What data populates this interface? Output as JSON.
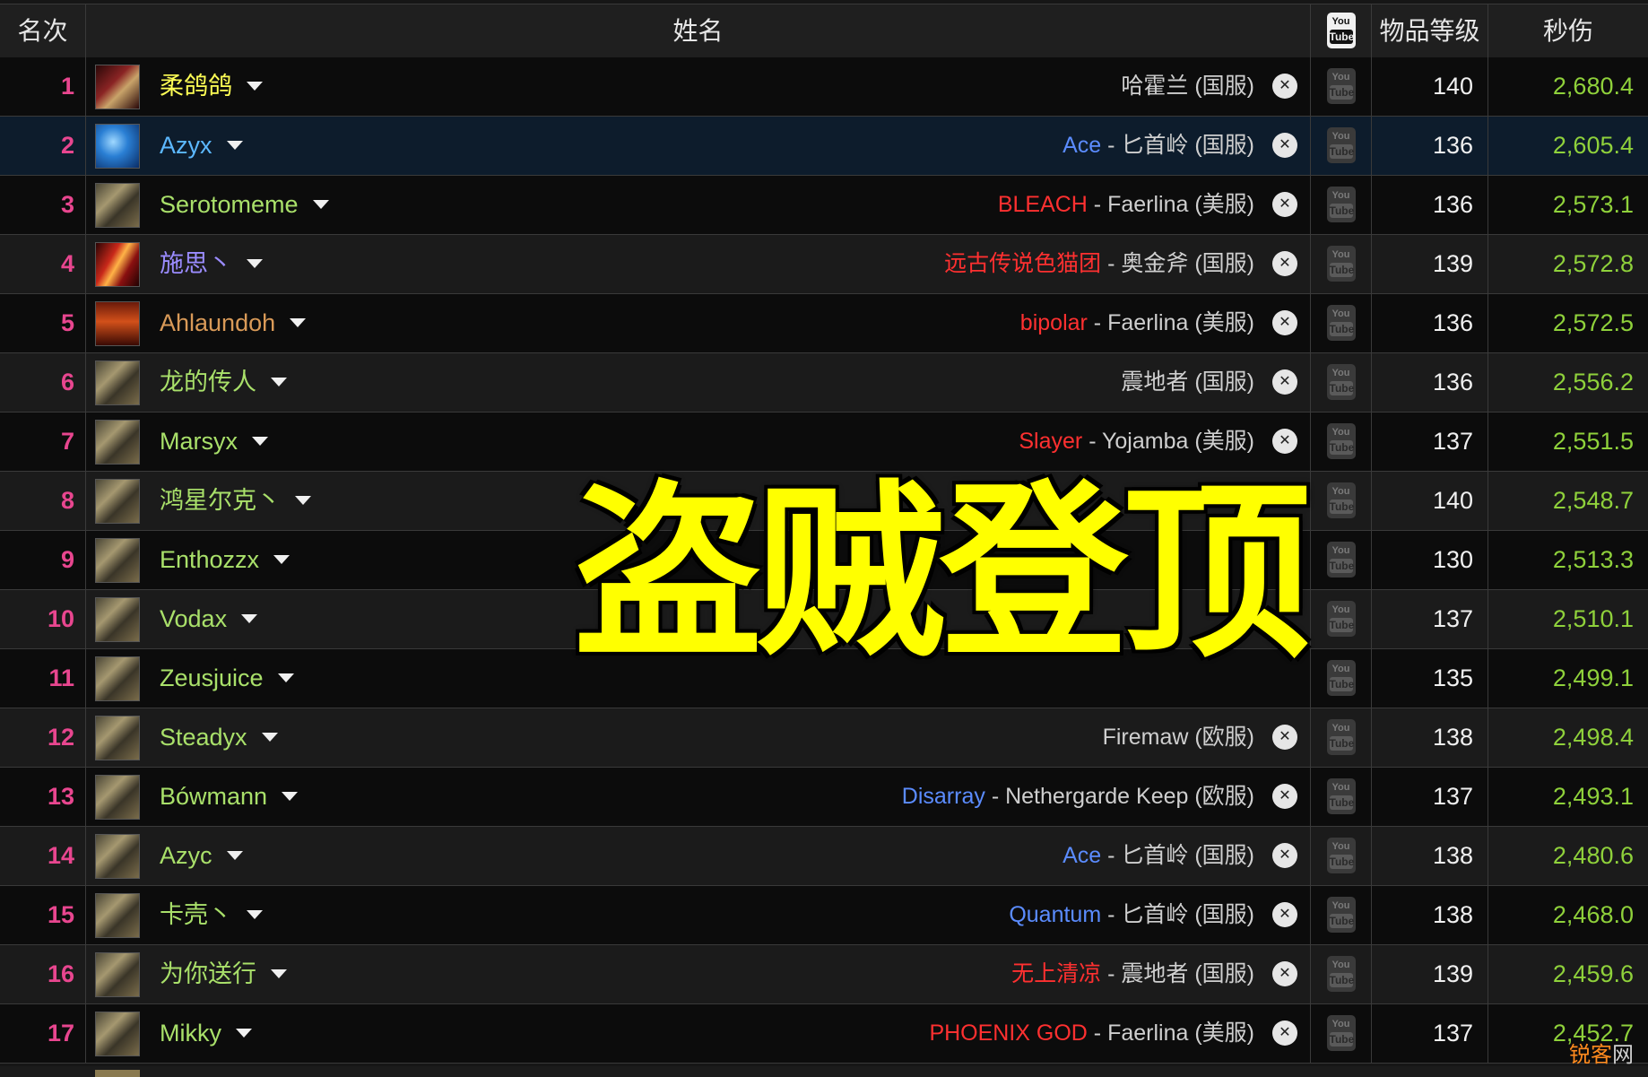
{
  "header": {
    "rank": "名次",
    "name": "姓名",
    "youtube_top": "You",
    "youtube_bottom": "Tube",
    "ilvl": "物品等级",
    "dps": "秒伤"
  },
  "rows": [
    {
      "rank": "1",
      "name": "柔鸽鸽",
      "name_color": "#ffff55",
      "spec": "dk",
      "guild": "",
      "realm": "哈霍兰 (国服)",
      "ilvl": "140",
      "dps": "2,680.4"
    },
    {
      "rank": "2",
      "name": "Azyx",
      "name_color": "#5cb8ff",
      "spec": "mage",
      "guild": "Ace",
      "guild_color": "#5b8cff",
      "realm": "匕首岭 (国服)",
      "ilvl": "136",
      "dps": "2,605.4"
    },
    {
      "rank": "3",
      "name": "Serotomeme",
      "name_color": "#a9e06a",
      "spec": "rogue",
      "guild": "BLEACH",
      "guild_color": "#ff3030",
      "realm": "Faerlina (美服)",
      "ilvl": "136",
      "dps": "2,573.1"
    },
    {
      "rank": "4",
      "name": "施思丶",
      "name_color": "#9b8cff",
      "spec": "fire",
      "guild": "远古传说色猫团",
      "guild_color": "#ff3030",
      "realm": "奥金斧 (国服)",
      "ilvl": "139",
      "dps": "2,572.8"
    },
    {
      "rank": "5",
      "name": "Ahlaundoh",
      "name_color": "#d99a58",
      "spec": "warr",
      "guild": "bipolar",
      "guild_color": "#ff3030",
      "realm": "Faerlina (美服)",
      "ilvl": "136",
      "dps": "2,572.5"
    },
    {
      "rank": "6",
      "name": "龙的传人",
      "name_color": "#a9e06a",
      "spec": "rogue",
      "guild": "",
      "realm": "震地者 (国服)",
      "ilvl": "136",
      "dps": "2,556.2"
    },
    {
      "rank": "7",
      "name": "Marsyx",
      "name_color": "#a9e06a",
      "spec": "rogue",
      "guild": "Slayer",
      "guild_color": "#ff3030",
      "realm": "Yojamba (美服)",
      "ilvl": "137",
      "dps": "2,551.5"
    },
    {
      "rank": "8",
      "name": "鸿星尔克丶",
      "name_color": "#a9e06a",
      "spec": "rogue",
      "guild": "",
      "realm": "",
      "ilvl": "140",
      "dps": "2,548.7"
    },
    {
      "rank": "9",
      "name": "Enthozzx",
      "name_color": "#a9e06a",
      "spec": "rogue",
      "guild": "",
      "realm": "",
      "ilvl": "130",
      "dps": "2,513.3"
    },
    {
      "rank": "10",
      "name": "Vodax",
      "name_color": "#a9e06a",
      "spec": "rogue",
      "guild": "",
      "realm": "",
      "ilvl": "137",
      "dps": "2,510.1"
    },
    {
      "rank": "11",
      "name": "Zeusjuice",
      "name_color": "#a9e06a",
      "spec": "rogue",
      "guild": "",
      "realm": "",
      "ilvl": "135",
      "dps": "2,499.1"
    },
    {
      "rank": "12",
      "name": "Steadyx",
      "name_color": "#a9e06a",
      "spec": "rogue",
      "guild": "",
      "realm": "Firemaw (欧服)",
      "ilvl": "138",
      "dps": "2,498.4"
    },
    {
      "rank": "13",
      "name": "Bówmann",
      "name_color": "#a9e06a",
      "spec": "rogue",
      "guild": "Disarray",
      "guild_color": "#5b8cff",
      "realm": "Nethergarde Keep (欧服)",
      "ilvl": "137",
      "dps": "2,493.1"
    },
    {
      "rank": "14",
      "name": "Azyc",
      "name_color": "#a9e06a",
      "spec": "rogue",
      "guild": "Ace",
      "guild_color": "#5b8cff",
      "realm": "匕首岭 (国服)",
      "ilvl": "138",
      "dps": "2,480.6"
    },
    {
      "rank": "15",
      "name": "卡壳丶",
      "name_color": "#a9e06a",
      "spec": "rogue",
      "guild": "Quantum",
      "guild_color": "#5b8cff",
      "realm": "匕首岭 (国服)",
      "ilvl": "138",
      "dps": "2,468.0"
    },
    {
      "rank": "16",
      "name": "为你送行",
      "name_color": "#a9e06a",
      "spec": "rogue",
      "guild": "无上清凉",
      "guild_color": "#ff3030",
      "realm": "震地者 (国服)",
      "ilvl": "139",
      "dps": "2,459.6"
    },
    {
      "rank": "17",
      "name": "Mikky",
      "name_color": "#a9e06a",
      "spec": "rogue",
      "guild": "PHOENIX GOD",
      "guild_color": "#ff3030",
      "realm": "Faerlina (美服)",
      "ilvl": "137",
      "dps": "2,452.7"
    }
  ],
  "separator": " - ",
  "row_youtube_top": "You",
  "row_youtube_bottom": "Tube",
  "overlay_title": "盗贼登顶",
  "watermark_a": "锐客",
  "watermark_b": "网",
  "colors": {
    "rank": "#e8468f",
    "dps": "#8fd13b",
    "overlay": "#ffff00"
  }
}
